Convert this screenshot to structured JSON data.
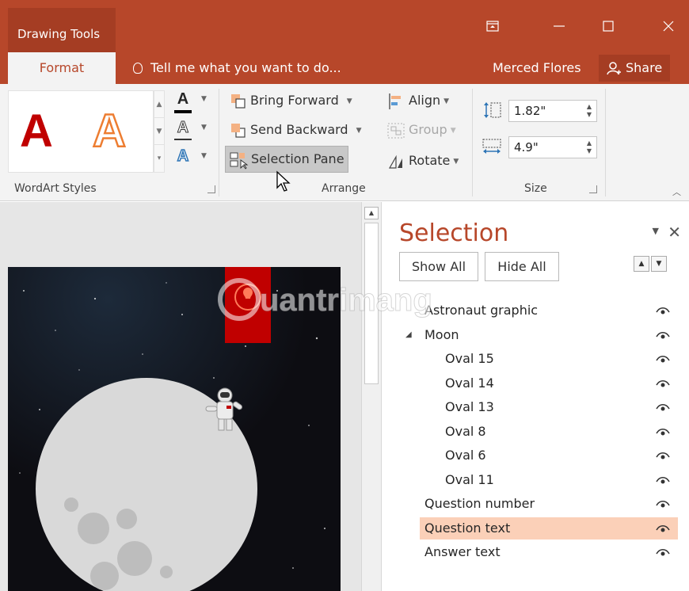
{
  "title_bar": {
    "contextual_tab": "Drawing Tools",
    "window_buttons": [
      "ribbon-display-options",
      "minimize",
      "maximize",
      "close"
    ]
  },
  "tab_row": {
    "format_tab": "Format",
    "tell_me": "Tell me what you want to do...",
    "user": "Merced Flores",
    "share": "Share"
  },
  "ribbon": {
    "wordart_group_label": "WordArt Styles",
    "arrange_group_label": "Arrange",
    "size_group_label": "Size",
    "bring_forward": "Bring Forward",
    "send_backward": "Send Backward",
    "selection_pane": "Selection Pane",
    "align": "Align",
    "group": "Group",
    "rotate": "Rotate",
    "height_value": "1.82\"",
    "width_value": "4.9\"",
    "wordart_samples": [
      "A",
      "A"
    ],
    "text_effect_glyphs": [
      "A",
      "A",
      "A"
    ],
    "colors": {
      "accent": "#b7472a",
      "wordart_red": "#c00000",
      "wordart_orange": "#ed7d31"
    }
  },
  "selection_pane": {
    "title": "Selection",
    "show_all": "Show All",
    "hide_all": "Hide All",
    "items": [
      {
        "label": "Astronaut graphic",
        "level": 0,
        "selected": false
      },
      {
        "label": "Moon",
        "level": 0,
        "group": true,
        "selected": false
      },
      {
        "label": "Oval 15",
        "level": 1,
        "selected": false
      },
      {
        "label": "Oval 14",
        "level": 1,
        "selected": false
      },
      {
        "label": "Oval 13",
        "level": 1,
        "selected": false
      },
      {
        "label": "Oval 8",
        "level": 1,
        "selected": false
      },
      {
        "label": "Oval 6",
        "level": 1,
        "selected": false
      },
      {
        "label": "Oval 11",
        "level": 1,
        "selected": false
      },
      {
        "label": "Question number",
        "level": 0,
        "selected": false
      },
      {
        "label": "Question text",
        "level": 0,
        "selected": true
      },
      {
        "label": "Answer text",
        "level": 0,
        "selected": false
      }
    ],
    "selected_color": "#fbd0b8"
  },
  "watermark": {
    "text": "uantrimang"
  }
}
